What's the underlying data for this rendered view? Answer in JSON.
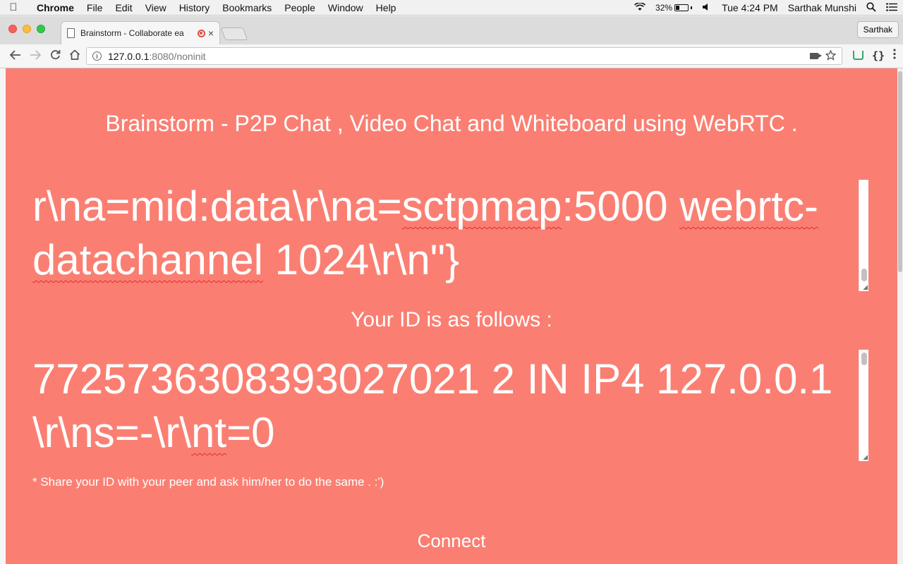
{
  "menubar": {
    "app": "Chrome",
    "items": [
      "File",
      "Edit",
      "View",
      "History",
      "Bookmarks",
      "People",
      "Window",
      "Help"
    ],
    "battery_percent": "32%",
    "clock": "Tue 4:24 PM",
    "user": "Sarthak Munshi"
  },
  "tab": {
    "title": "Brainstorm - Collaborate ea",
    "close_label": "×"
  },
  "profile": {
    "name": "Sarthak"
  },
  "address": {
    "host": "127.0.0.1",
    "path": ":8080/noninit"
  },
  "page": {
    "heading": "Brainstorm - P2P Chat , Video Chat and Whiteboard using WebRTC .",
    "box1": {
      "seg1": "r\\na=mid:data\\r\\na=",
      "seg2": "sctpmap",
      "seg3": ":5000 ",
      "seg4": "webrtc-",
      "seg5": "datachannel",
      "seg6": " 1024\\r\\n\"}"
    },
    "id_label": "Your ID is as follows :",
    "box2": {
      "seg1": "7725736308393027021 2 IN IP4 127.0.0.1\\r\\ns=-\\r\\",
      "seg2": "nt",
      "seg3": "=0"
    },
    "note": "* Share your ID with your peer and ask him/her to do the same . :')",
    "connect_label": "Connect"
  },
  "colors": {
    "page_bg": "#fa7f72",
    "text": "#ffffff"
  },
  "icons": {
    "back": "back-arrow-icon",
    "forward": "forward-arrow-icon",
    "reload": "reload-icon",
    "home": "home-icon",
    "bookmark": "star-icon"
  }
}
